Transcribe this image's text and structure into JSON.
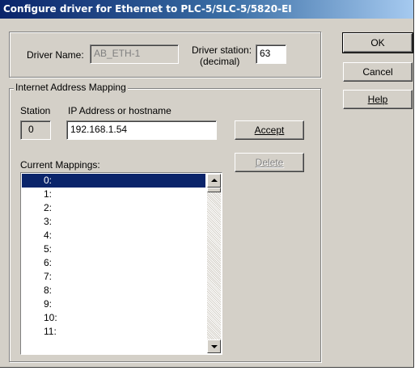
{
  "window": {
    "title": "Configure driver for Ethernet to PLC-5/SLC-5/5820-EI"
  },
  "driver": {
    "name_label": "Driver Name:",
    "name_value": "AB_ETH-1",
    "station_label_line1": "Driver station:",
    "station_label_line2": "(decimal)",
    "station_value": "63"
  },
  "mapping": {
    "group_title": "Internet Address Mapping",
    "station_header": "Station",
    "ip_header": "IP Address or hostname",
    "station_value": "0",
    "ip_value": "192.168.1.54",
    "current_label": "Current Mappings:",
    "rows": [
      "0:",
      "1:",
      "2:",
      "3:",
      "4:",
      "5:",
      "6:",
      "7:",
      "8:",
      "9:",
      "10:",
      "11:"
    ],
    "selected_index": 0
  },
  "buttons": {
    "ok": "OK",
    "cancel": "Cancel",
    "help": "Help",
    "accept": "Accept",
    "delete": "Delete"
  },
  "icons": [
    "scroll-up-arrow",
    "scroll-down-arrow"
  ]
}
